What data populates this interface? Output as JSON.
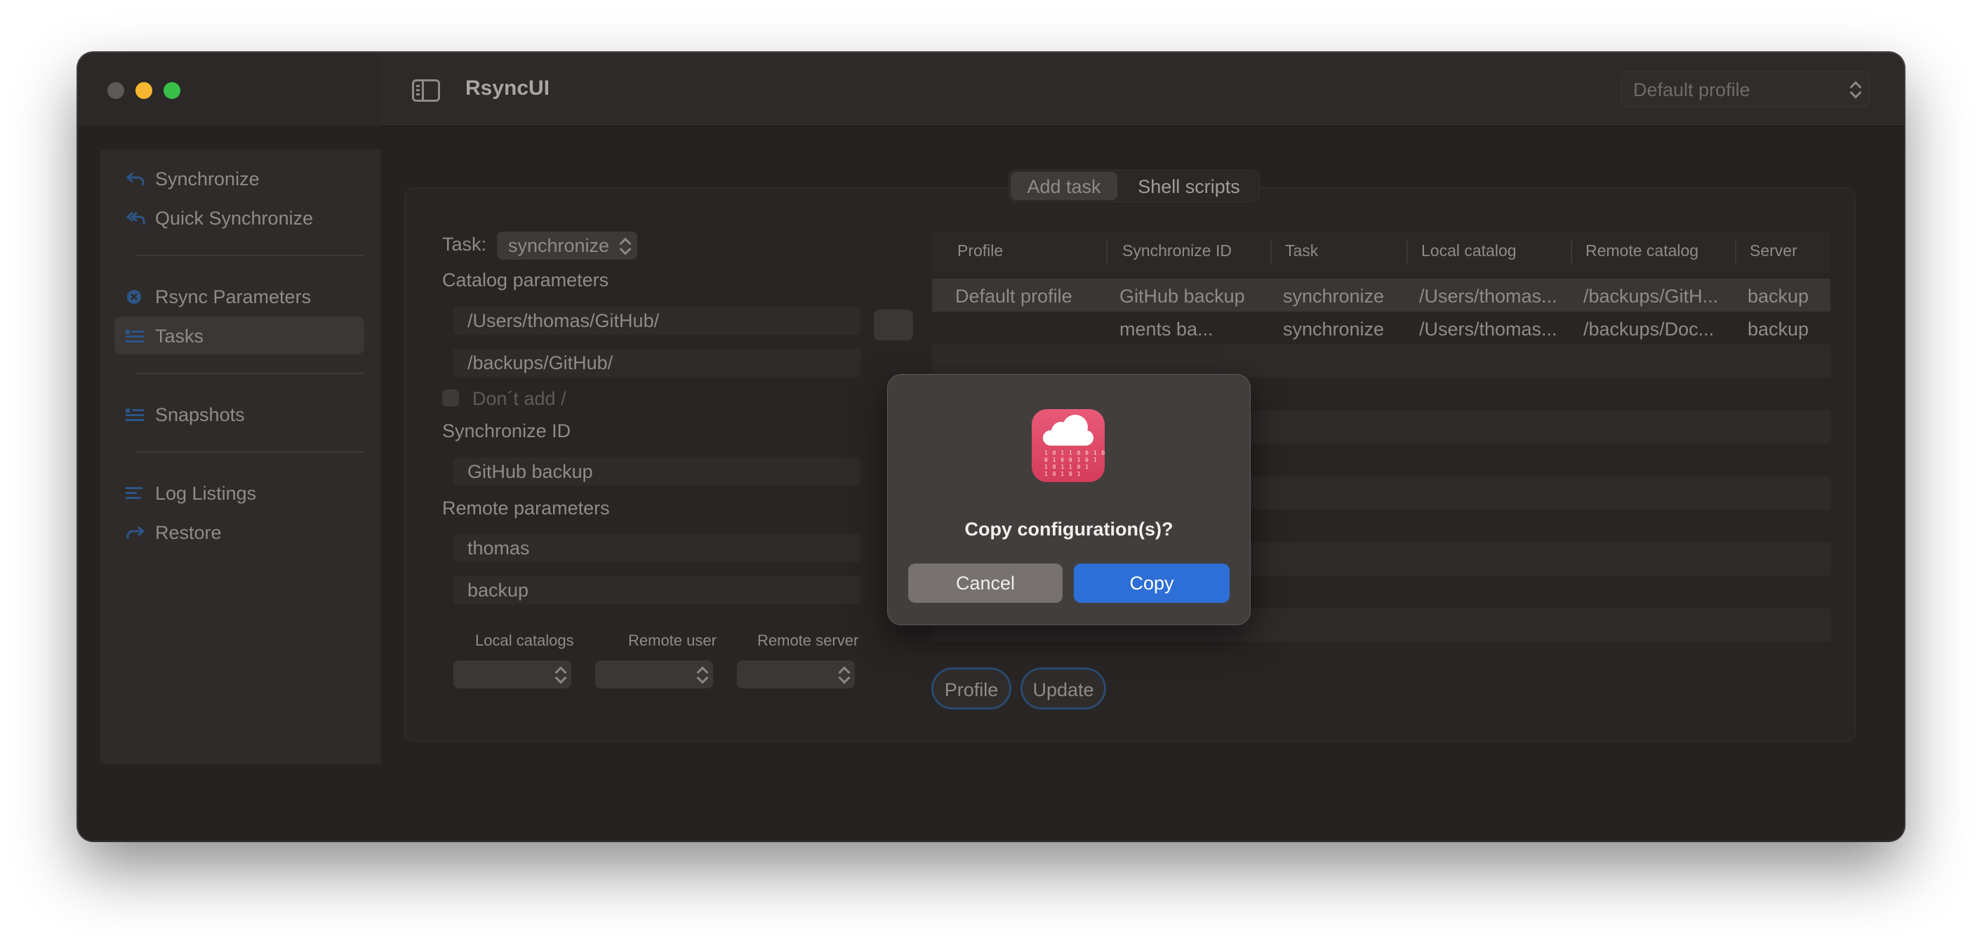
{
  "window": {
    "title": "RsyncUI"
  },
  "header": {
    "profile_select": "Default profile"
  },
  "sidebar": {
    "items": [
      {
        "label": "Synchronize",
        "icon": "sync-arrows-icon"
      },
      {
        "label": "Quick Synchronize",
        "icon": "sync-arrows-icon"
      },
      {
        "label": "Rsync Parameters",
        "icon": "x-circle-icon"
      },
      {
        "label": "Tasks",
        "icon": "list-icon",
        "selected": true
      },
      {
        "label": "Snapshots",
        "icon": "list-icon"
      },
      {
        "label": "Log Listings",
        "icon": "lines-icon"
      },
      {
        "label": "Restore",
        "icon": "restore-arrow-icon"
      }
    ]
  },
  "segmented": {
    "add_task": "Add task",
    "shell_scripts": "Shell scripts"
  },
  "form": {
    "task_label": "Task:",
    "task_value": "synchronize",
    "catalog_parameters_label": "Catalog parameters",
    "local_catalog_value": "/Users/thomas/GitHub/",
    "remote_catalog_value": "/backups/GitHub/",
    "dont_add_slash_label": "Don´t add /",
    "synchronize_id_label": "Synchronize ID",
    "synchronize_id_value": "GitHub backup",
    "remote_parameters_label": "Remote parameters",
    "remote_user_value": "thomas",
    "remote_server_value": "backup",
    "local_catalogs_label": "Local catalogs",
    "remote_user_label": "Remote user",
    "remote_server_label": "Remote server"
  },
  "table": {
    "headers": [
      "Profile",
      "Synchronize ID",
      "Task",
      "Local catalog",
      "Remote catalog",
      "Server"
    ],
    "rows": [
      {
        "profile": "Default profile",
        "synchronize_id": "GitHub backup",
        "task": "synchronize",
        "local_catalog": "/Users/thomas...",
        "remote_catalog": "/backups/GitH...",
        "server": "backup"
      },
      {
        "profile": "",
        "synchronize_id": "ments ba...",
        "task": "synchronize",
        "local_catalog": "/Users/thomas...",
        "remote_catalog": "/backups/Doc...",
        "server": "backup"
      }
    ]
  },
  "buttons": {
    "profile": "Profile",
    "update": "Update"
  },
  "modal": {
    "title": "Copy configuration(s)?",
    "cancel": "Cancel",
    "copy": "Copy",
    "icon_bits": "1 0 1 1 0 0 1 0\n0 1 0 0 1 0 1\n1 0 1 1 0 1\n1 0 1 0 1"
  },
  "colors": {
    "window_bg": "#252221",
    "accent_blue": "#2d6fd6",
    "traffic_red": "#5d5958",
    "traffic_yellow": "#f8b631",
    "traffic_green": "#38c048",
    "app_icon": "#e04d6a"
  }
}
